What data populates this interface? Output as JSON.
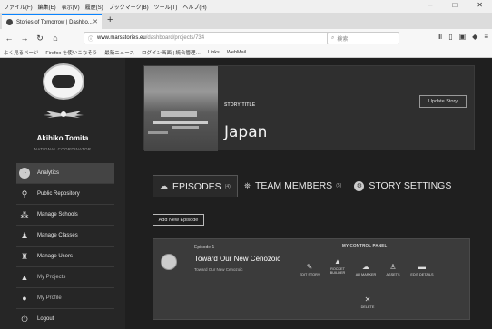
{
  "browser": {
    "menu": [
      "ファイル(F)",
      "編集(E)",
      "表示(V)",
      "履歴(S)",
      "ブックマーク(B)",
      "ツール(T)",
      "ヘルプ(H)"
    ],
    "tab_title": "Stories of Tomorrow | Dashbo...",
    "url_host": "www.marsstories.eu",
    "url_path": "/dashboard/projects/734",
    "search_placeholder": "検索",
    "bookmarks": [
      "よく見るページ",
      "Firefox を使いこなそう",
      "最新ニュース",
      "ログイン画面 | 統合管理…",
      "Links",
      "WebMail"
    ]
  },
  "user": {
    "name": "Akihiko Tomita",
    "role": "NATIONAL COORDINATOR"
  },
  "sidebar": {
    "items": [
      {
        "label": "Analytics",
        "icon": "analytics-icon"
      },
      {
        "label": "Public Repository",
        "icon": "repository-icon"
      },
      {
        "label": "Manage Schools",
        "icon": "schools-icon"
      },
      {
        "label": "Manage Classes",
        "icon": "classes-icon"
      },
      {
        "label": "Manage Users",
        "icon": "users-icon"
      },
      {
        "label": "My Projects",
        "icon": "projects-icon"
      },
      {
        "label": "My Profile",
        "icon": "profile-icon"
      },
      {
        "label": "Logout",
        "icon": "logout-icon"
      }
    ]
  },
  "story": {
    "title_label": "STORY TITLE",
    "title": "Japan",
    "update_label": "Update Story"
  },
  "tabs": [
    {
      "label": "EPISODES",
      "count": "(4)"
    },
    {
      "label": "TEAM MEMBERS",
      "count": "(5)"
    },
    {
      "label": "STORY SETTINGS",
      "count": ""
    }
  ],
  "add_episode_label": "Add New Episode",
  "episode": {
    "number": "Episode 1",
    "title": "Toward Our New Cenozoic",
    "subtitle": "Toward Our New Cenozoic",
    "control_panel_label": "MY CONTROL PANEL",
    "controls": [
      "EDIT STORY",
      "ROCKET BUILDER",
      "AR MARKER",
      "ASSETS",
      "EDIT DETAILS",
      "DELETE"
    ]
  }
}
